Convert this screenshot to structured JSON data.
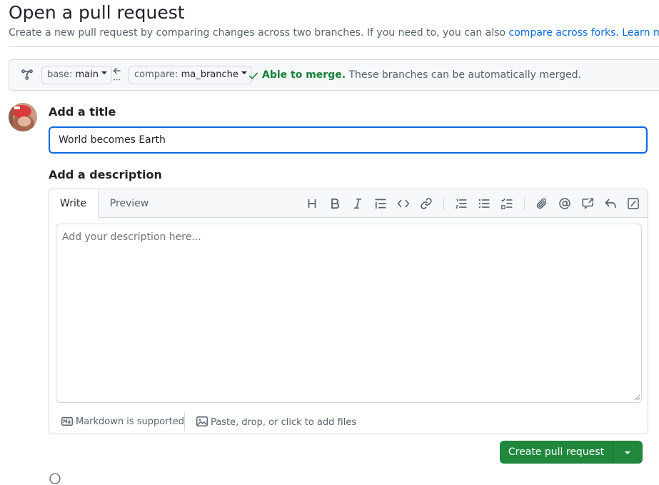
{
  "page": {
    "title": "Open a pull request",
    "subtitle_text": "Create a new pull request by comparing changes across two branches. If you need to, you can also ",
    "subtitle_link_forks": "compare across forks.",
    "subtitle_link_learn": " Learn more about diff comparisons here."
  },
  "range": {
    "base_prefix": "base: ",
    "base_branch": "main",
    "compare_prefix": "compare: ",
    "compare_branch": "ma_branche",
    "merge_status": "Able to merge.",
    "merge_detail": " These branches can be automatically merged.",
    "accent_color": "#1a7f37"
  },
  "form": {
    "title_label": "Add a title",
    "title_value": "World becomes Earth",
    "description_label": "Add a description",
    "tabs": [
      {
        "label": "Write"
      },
      {
        "label": "Preview"
      }
    ],
    "description_placeholder": "Add your description here...",
    "markdown_hint": "Markdown is supported",
    "files_hint": "Paste, drop, or click to add files",
    "toolbar_icons": [
      "heading-icon",
      "bold-icon",
      "italic-icon",
      "quote-icon",
      "code-icon",
      "link-icon",
      "ordered-list-icon",
      "unordered-list-icon",
      "task-list-icon",
      "attach-icon",
      "mention-icon",
      "reference-icon",
      "undo-icon",
      "slash-commands-icon"
    ]
  },
  "actions": {
    "create_label": "Create pull request",
    "primary_color": "#1f883d"
  }
}
